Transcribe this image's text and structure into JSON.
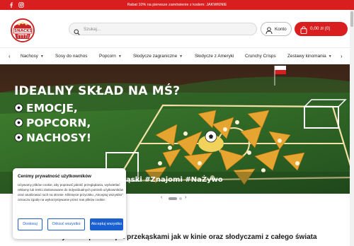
{
  "topbar": {
    "promo": "Rabat 10% na pierwsze zamówienie z kodem: JAKWKINIE",
    "social": [
      "facebook-icon",
      "instagram-icon"
    ]
  },
  "header": {
    "logo_text": "SNACKS",
    "logo_sub": "CRUNCHY",
    "search_placeholder": "Szukaj...",
    "account_label": "Konto",
    "cart_label": "0,00 zł (0)"
  },
  "nav": {
    "items": [
      {
        "label": "Nachosy",
        "dropdown": true
      },
      {
        "label": "Sosy do nachos",
        "dropdown": false
      },
      {
        "label": "Popcorn",
        "dropdown": true
      },
      {
        "label": "Słodycze zagraniczne",
        "dropdown": true
      },
      {
        "label": "Słodycze z Ameryki",
        "dropdown": false
      },
      {
        "label": "Crunchy Crisps",
        "dropdown": false
      },
      {
        "label": "Zestawy kinomania",
        "dropdown": true
      }
    ]
  },
  "hero": {
    "headline": "IDEALNY SKŁAD NA MŚ?",
    "lines": [
      "EMOCJE,",
      "POPCORN,",
      "NACHOSY!"
    ],
    "hashtags": "ąski #Znajomi #NaŻywo"
  },
  "main": {
    "subtitle": "CrunchySnack.pl - sklep z przekąskami jak w kinie oraz słodyczami z całego świata"
  },
  "cookie": {
    "title": "Cenimy prywatność użytkowników",
    "body": "Używamy plików cookie, aby poprawić jakość przeglądania, wyświetlać reklamy lub treści dostosowane do indywidualnych potrzeb użytkowników oraz analizować ruch na stronie. Kliknięcie przycisku „Akceptuj wszystko” oznacza zgodę na wykorzystywanie przez nas plików cookie.",
    "buttons": [
      "Dostosuj",
      "Odrzuć wszystko",
      "Akceptuj wszystko"
    ]
  },
  "colors": {
    "brand": "#d81e1e",
    "cookie_accent": "#1a5fd0",
    "pitch": "#2e6b2a"
  }
}
